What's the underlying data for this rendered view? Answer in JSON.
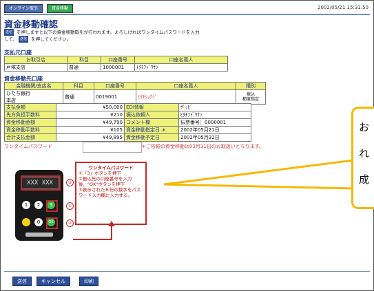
{
  "tabs": [
    "オンライン取引",
    "資金移動"
  ],
  "timestamp": "2002/05/21 15:31:50",
  "title": "資金移動確認",
  "instruction": {
    "btn": "送信",
    "text_a": "を押しますと以下の資金移動取引が行われます。よろしければワンタイムパスワードを入力",
    "text_b": "して、",
    "btn2": "送信",
    "text_c": "を押してください。"
  },
  "payer": {
    "section": "支払元口座",
    "headers": [
      "お取引店",
      "科目",
      "口座番号",
      "口座名義人"
    ],
    "row": [
      "戸塚支店",
      "普通",
      "1000001",
      "ﾄﾀﾁﾌﾄﾞｳｻﾝ"
    ]
  },
  "payee": {
    "section": "資金移動先口座",
    "headers": [
      "金融機関/支店名",
      "科目",
      "口座番号",
      "口座名義人",
      "種別"
    ],
    "row": [
      "ひたち銀行\n本店",
      "普通",
      "0019001",
      "ﾋﾀﾁｼｮｳｼﾞ",
      "振込\n都度指定"
    ]
  },
  "amounts": {
    "left": [
      {
        "label": "支払金額",
        "value": "¥50,000"
      },
      {
        "label": "先方負担手数料",
        "value": "¥210"
      },
      {
        "label": "資金移動金額",
        "value": "¥49,790"
      },
      {
        "label": "資金移動手数料",
        "value": "¥105"
      },
      {
        "label": "合計支払金額",
        "value": "¥49,895"
      }
    ],
    "right": [
      {
        "label": "EDI情報",
        "value": "ｻﾞｯﾋﾞ"
      },
      {
        "label": "振込依頼人",
        "value": "ﾋﾀﾁﾌﾄﾞｳｻﾝ"
      },
      {
        "label": "コメント欄",
        "value": "伝票番号：0000001"
      },
      {
        "label": "資金移動指定日 ＊",
        "value": "2002年05月21日"
      },
      {
        "label": "資金移動予定日",
        "value": "2002年05月22日"
      }
    ]
  },
  "otp": {
    "label": "ワンタイムパスワード",
    "value": "",
    "note": "＊ご依頼の資金移動は03月31日のお取扱いとなります。"
  },
  "help": {
    "title": "ワンタイムパスワード",
    "steps": [
      "①「3」ボタンを押下",
      "②振込先の口座番号を入力後、\"OK\"ボタンを押下",
      "③表示された６桁の数字をパスワード入力欄に入力する。"
    ]
  },
  "device": {
    "screen": "XXX XXX",
    "keys": [
      "1",
      "2",
      "3",
      "0",
      "OK"
    ],
    "markers": [
      "③",
      "①",
      "②"
    ]
  },
  "callout": {
    "lines": [
      "お",
      "れ",
      "成"
    ]
  },
  "buttons": [
    "送信",
    "キャンセル",
    "印刷"
  ],
  "colors": {
    "header_blue": "#1f3a84",
    "table_yellow": "#eef27a",
    "accent_red": "#d04343",
    "callout_border": "#f6b800"
  }
}
